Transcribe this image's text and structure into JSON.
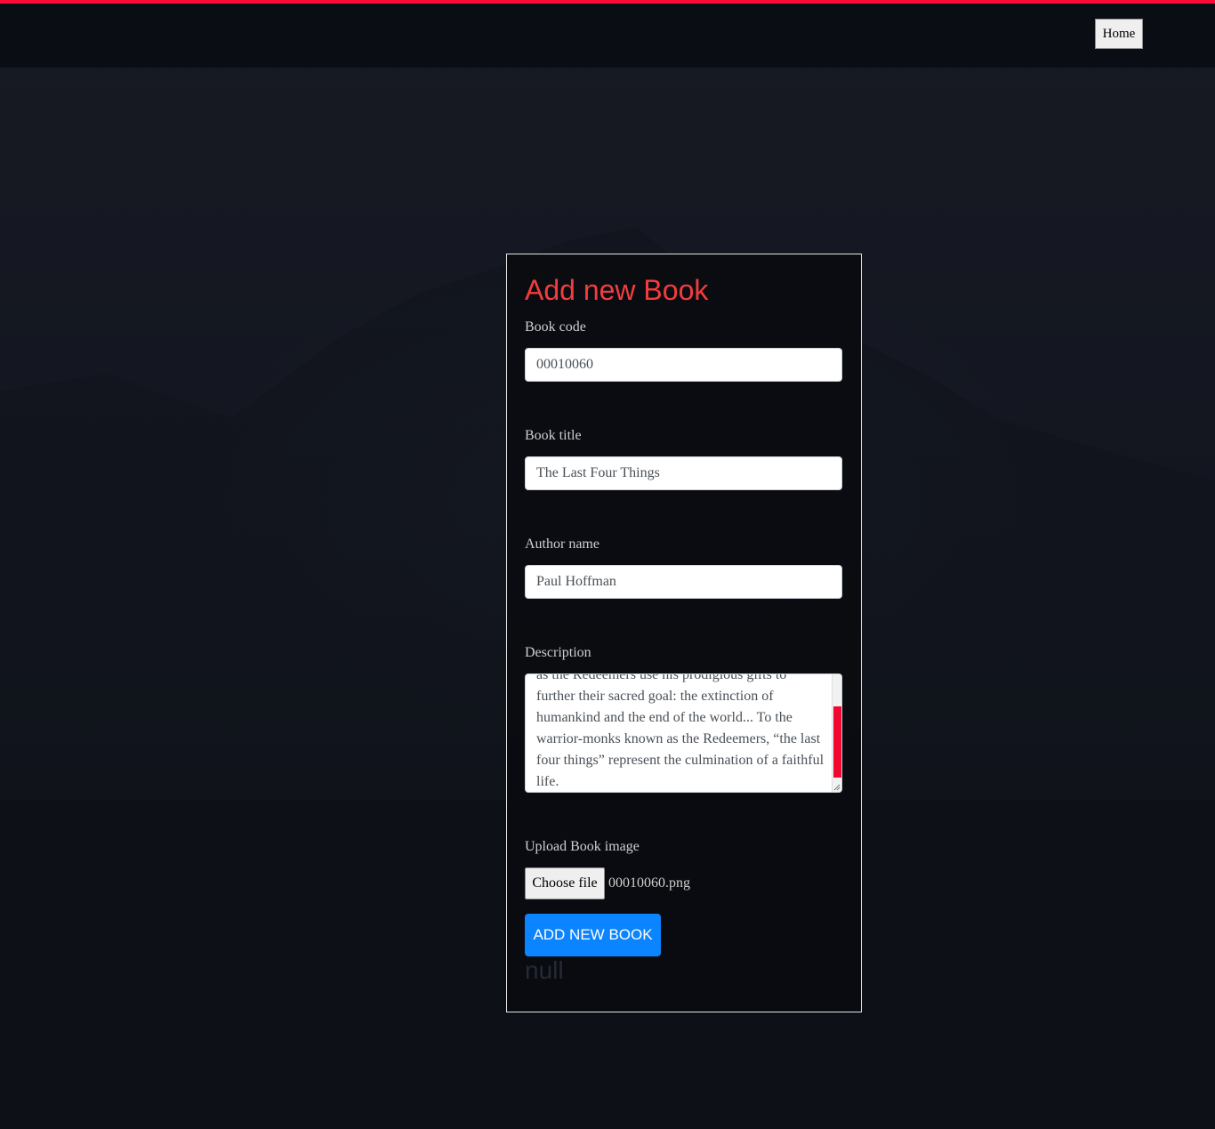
{
  "nav": {
    "home_label": "Home"
  },
  "form": {
    "title": "Add new Book",
    "book_code": {
      "label": "Book code",
      "value": "00010060"
    },
    "book_title": {
      "label": "Book title",
      "value": "The Last Four Things"
    },
    "author_name": {
      "label": "Author name",
      "value": "Paul Hoffman"
    },
    "description": {
      "label": "Description",
      "value": "as the Redeemers use his prodigious gifts to further their sacred goal: the extinction of humankind and the end of the world... To the warrior-monks known as the Redeemers, “the last four things” represent the culmination of a faithful life."
    },
    "image_upload": {
      "label": "Upload Book image",
      "button_label": "Choose file",
      "file_name": "00010060.png"
    },
    "submit_label": "ADD NEW BOOK",
    "status": "null"
  },
  "colors": {
    "accent_bar": "#ff0a37",
    "title": "#f23d3d",
    "submit_button": "#0a84ff",
    "scrollbar_thumb": "#f2072f"
  }
}
